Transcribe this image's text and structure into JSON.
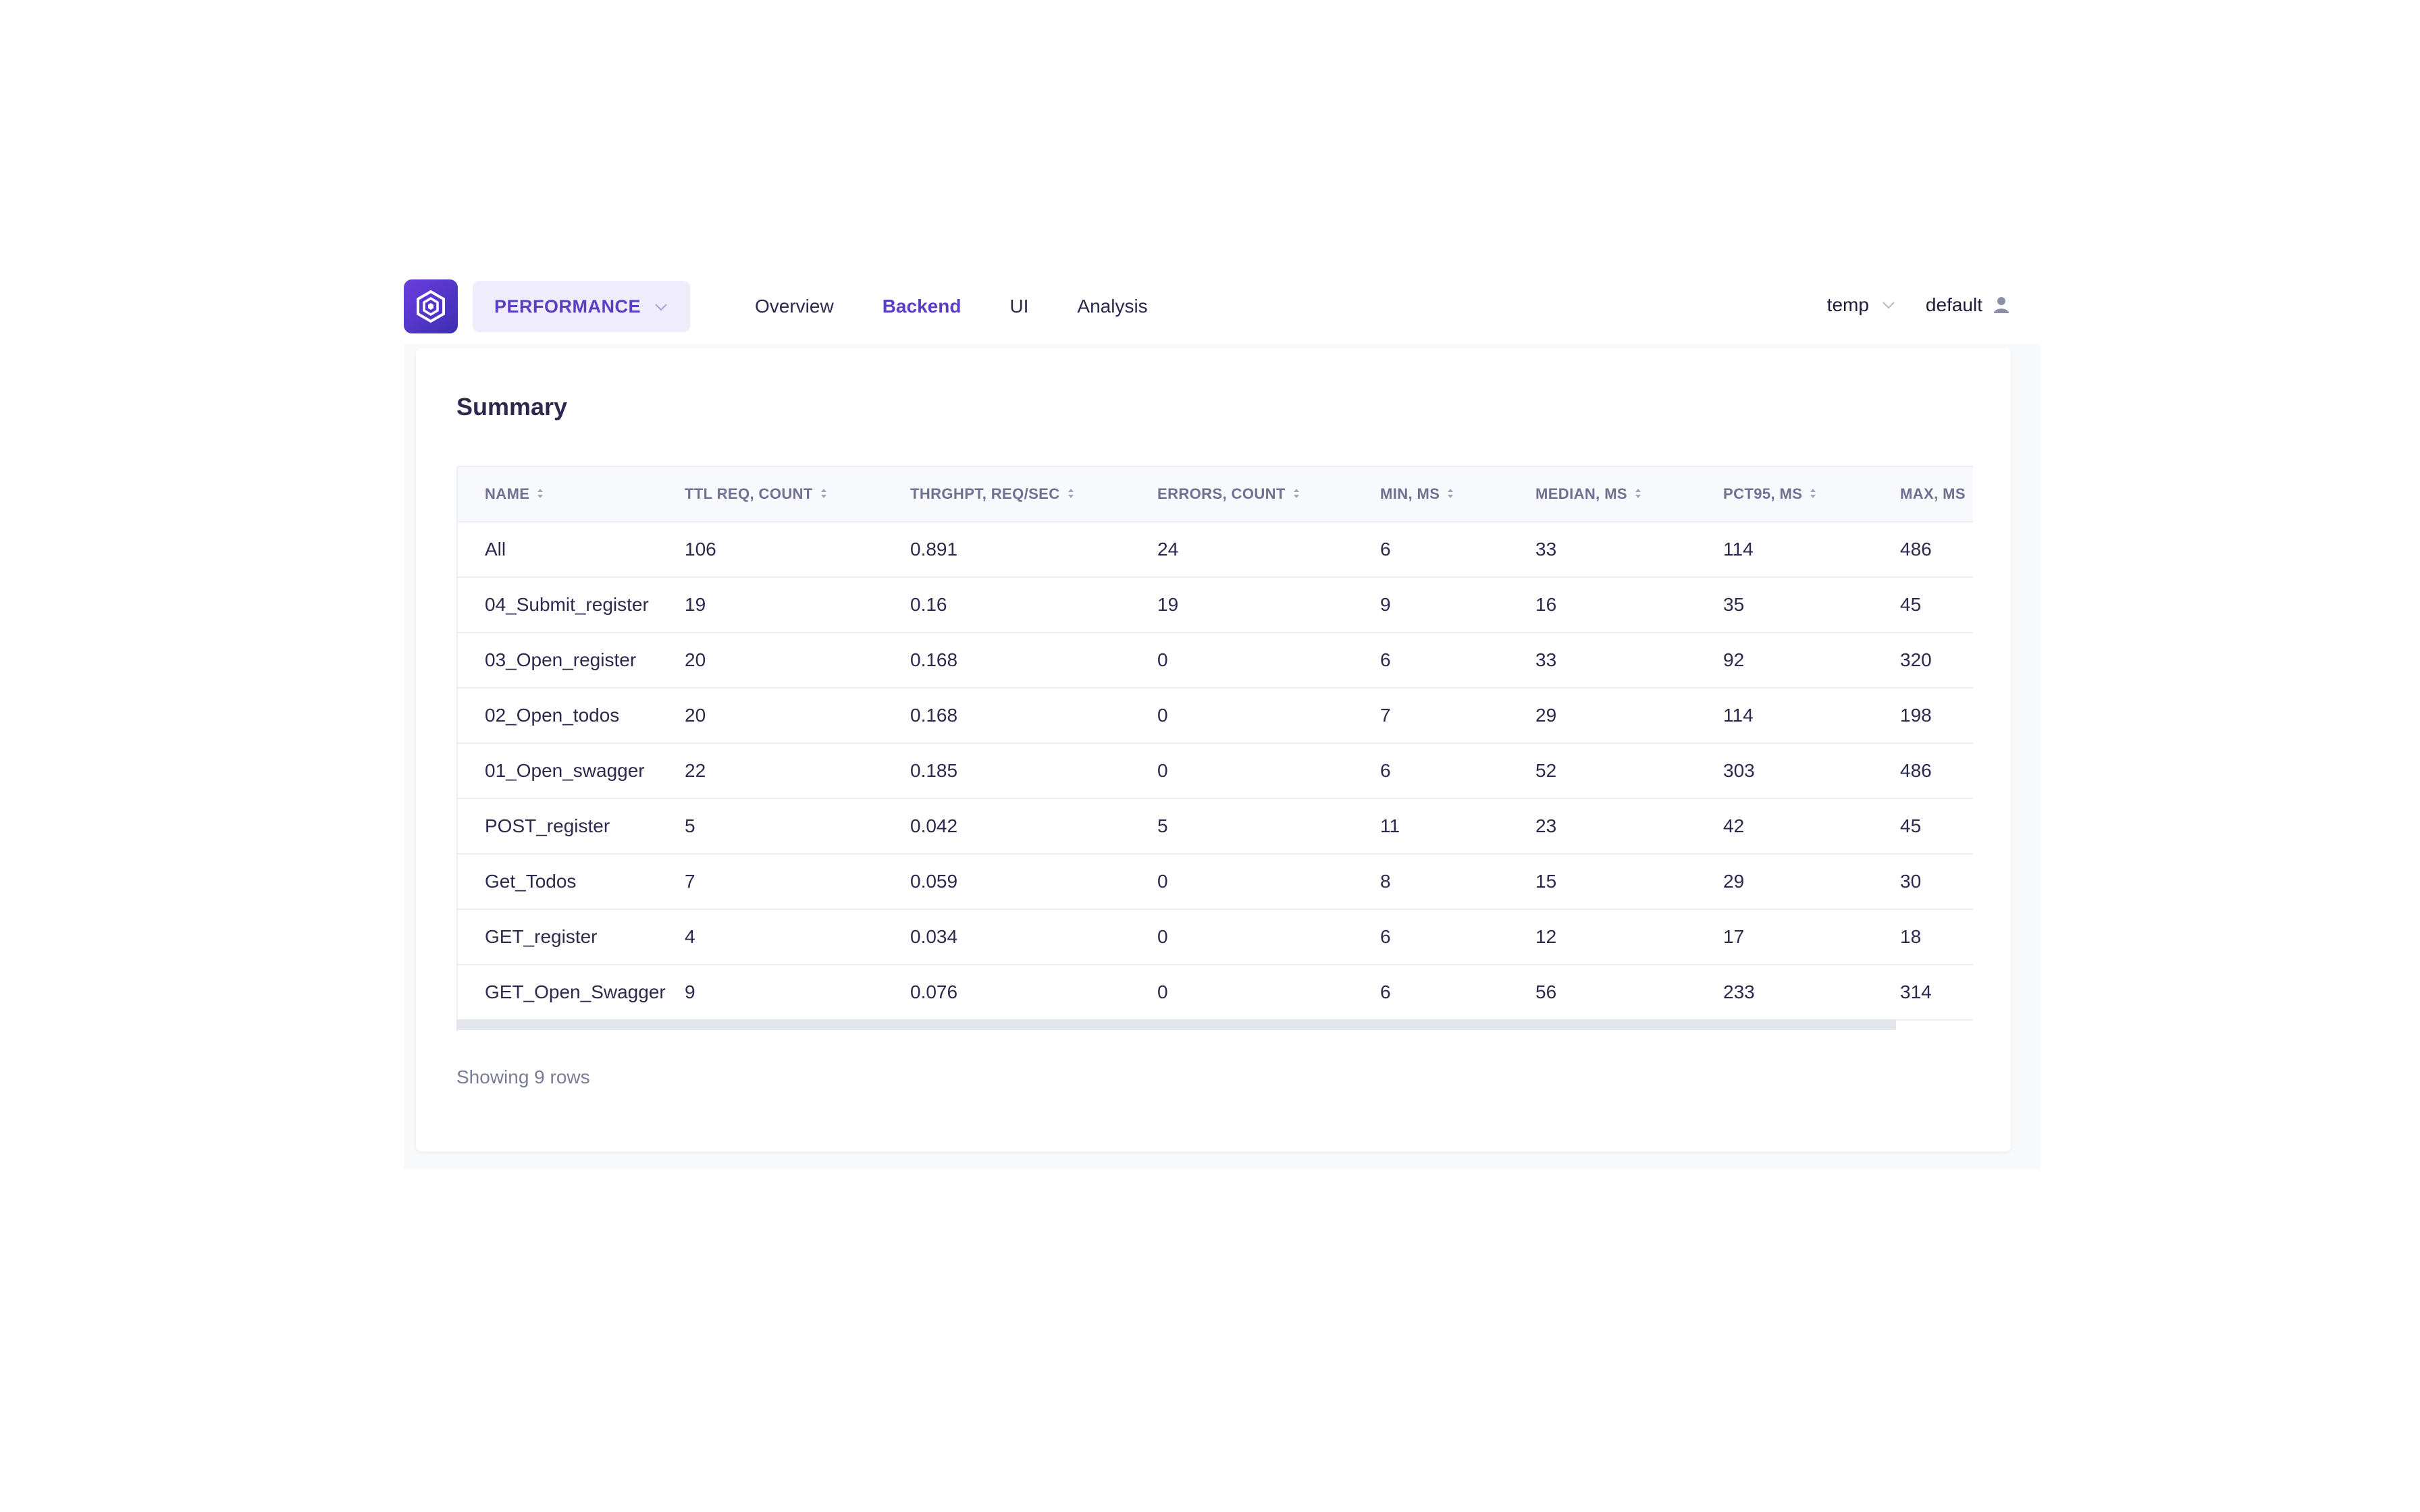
{
  "navbar": {
    "project": "PERFORMANCE",
    "links": [
      {
        "label": "Overview",
        "active": false
      },
      {
        "label": "Backend",
        "active": true
      },
      {
        "label": "UI",
        "active": false
      },
      {
        "label": "Analysis",
        "active": false
      }
    ],
    "environment": "temp",
    "user": "default"
  },
  "summary": {
    "title": "Summary",
    "columns": [
      "NAME",
      "TTL REQ, COUNT",
      "THRGHPT, REQ/SEC",
      "ERRORS, COUNT",
      "MIN, MS",
      "MEDIAN, MS",
      "PCT95, MS",
      "MAX, MS"
    ],
    "rows": [
      [
        "All",
        "106",
        "0.891",
        "24",
        "6",
        "33",
        "114",
        "486"
      ],
      [
        "04_Submit_register",
        "19",
        "0.16",
        "19",
        "9",
        "16",
        "35",
        "45"
      ],
      [
        "03_Open_register",
        "20",
        "0.168",
        "0",
        "6",
        "33",
        "92",
        "320"
      ],
      [
        "02_Open_todos",
        "20",
        "0.168",
        "0",
        "7",
        "29",
        "114",
        "198"
      ],
      [
        "01_Open_swagger",
        "22",
        "0.185",
        "0",
        "6",
        "52",
        "303",
        "486"
      ],
      [
        "POST_register",
        "5",
        "0.042",
        "5",
        "11",
        "23",
        "42",
        "45"
      ],
      [
        "Get_Todos",
        "7",
        "0.059",
        "0",
        "8",
        "15",
        "29",
        "30"
      ],
      [
        "GET_register",
        "4",
        "0.034",
        "0",
        "6",
        "12",
        "17",
        "18"
      ],
      [
        "GET_Open_Swagger",
        "9",
        "0.076",
        "0",
        "6",
        "56",
        "233",
        "314"
      ]
    ],
    "footer": "Showing 9 rows"
  },
  "colors": {
    "accent": "#5b3cc4",
    "logo_gradient_start": "#6c3de0",
    "logo_gradient_end": "#3c2fb4",
    "text": "#2b2a4c",
    "muted": "#7a7d98",
    "border": "#eceef4"
  },
  "icons": {
    "logo": "hexagon-logo-icon",
    "project_dropdown": "chevron-down-icon",
    "env_dropdown": "chevron-down-icon",
    "user": "user-icon",
    "sort": "sort-icon"
  }
}
